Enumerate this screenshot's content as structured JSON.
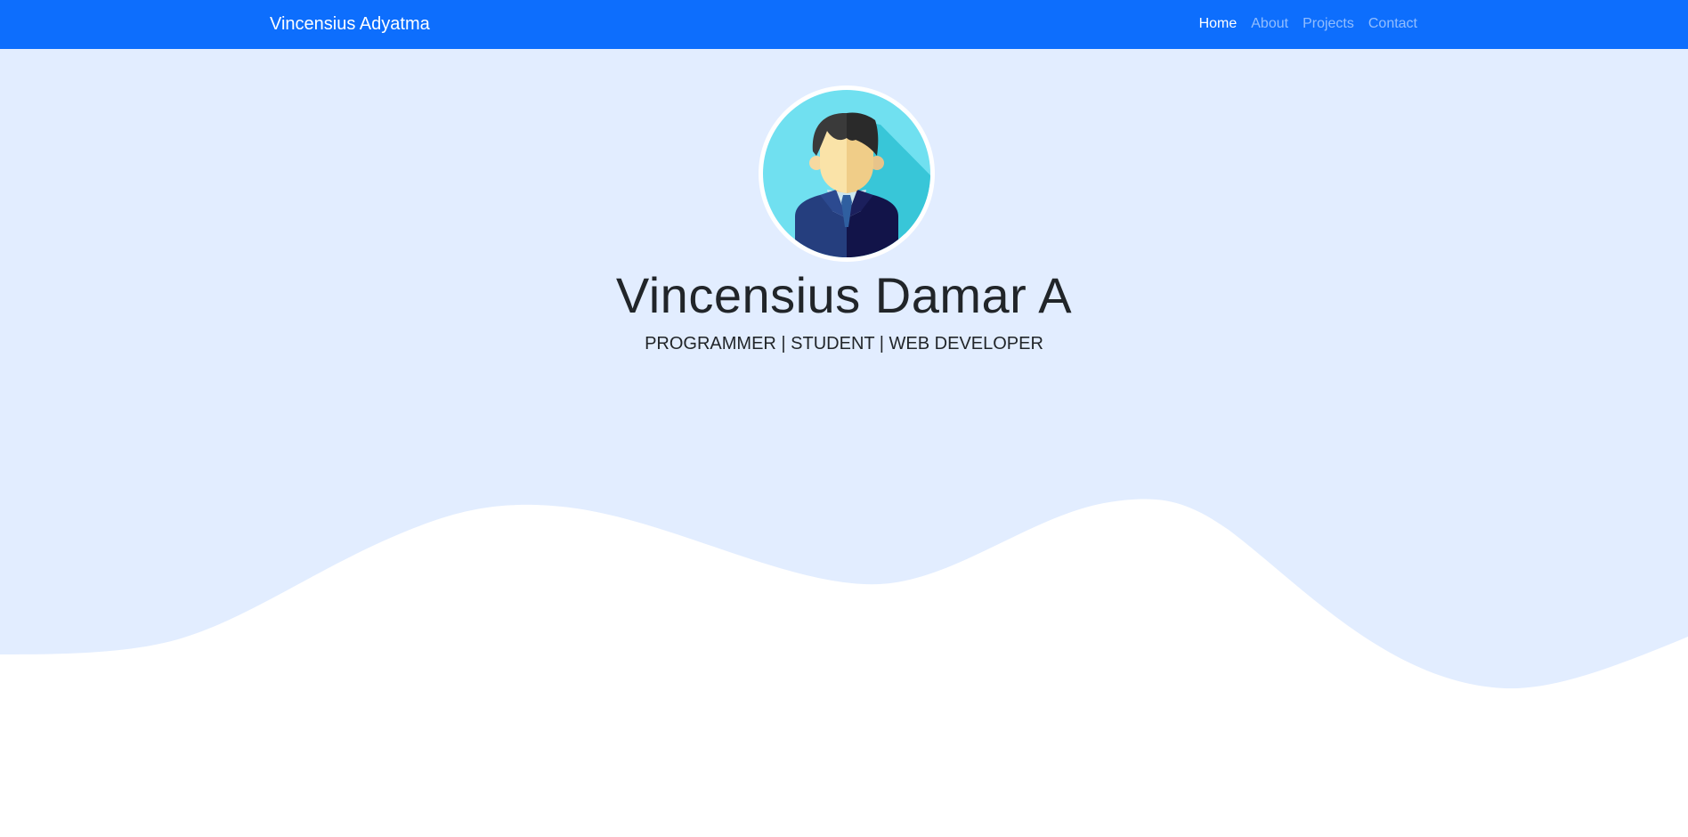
{
  "navbar": {
    "brand": "Vincensius Adyatma",
    "links": [
      {
        "label": "Home",
        "active": true
      },
      {
        "label": "About",
        "active": false
      },
      {
        "label": "Projects",
        "active": false
      },
      {
        "label": "Contact",
        "active": false
      }
    ]
  },
  "hero": {
    "name": "Vincensius Damar A",
    "tagline": "PROGRAMMER | STUDENT | WEB DEVELOPER",
    "avatar_icon": "man-avatar-icon"
  },
  "colors": {
    "navbar_bg": "#0d6efd",
    "hero_bg": "#e2edff",
    "text": "#212529"
  }
}
